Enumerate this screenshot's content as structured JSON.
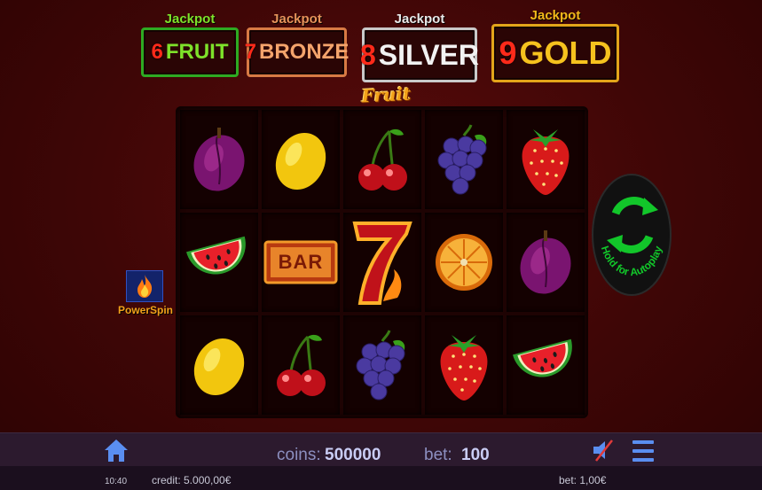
{
  "jackpots": [
    {
      "title": "Jackpot",
      "number": "6",
      "name": "FRUIT"
    },
    {
      "title": "Jackpot",
      "number": "7",
      "name": "BRONZE"
    },
    {
      "title": "Jackpot",
      "number": "8",
      "name": "SILVER"
    },
    {
      "title": "Jackpot",
      "number": "9",
      "name": "GOLD"
    }
  ],
  "game_title": "Fruit Fever",
  "reels": [
    [
      "plum",
      "watermelon",
      "lemon"
    ],
    [
      "lemon",
      "bar",
      "cherries"
    ],
    [
      "cherries",
      "seven",
      "grapes"
    ],
    [
      "grapes",
      "orange",
      "strawberry"
    ],
    [
      "strawberry",
      "plum",
      "watermelon"
    ]
  ],
  "bar_symbol_label": "BAR",
  "powerspin": {
    "label": "PowerSpin",
    "icon": "flame-icon"
  },
  "spin_button": {
    "label": "Hold for Autoplay",
    "icon": "refresh-arrows-icon",
    "color": "#12c62a"
  },
  "bottom_bar": {
    "coins_label": "coins:",
    "coins_value": "500000",
    "bet_label": "bet:",
    "bet_value": "100",
    "home_icon": "home-icon",
    "sound_icon": "speaker-muted-icon",
    "menu_icon": "hamburger-menu-icon"
  },
  "info_bar": {
    "time": "10:40",
    "credit": "credit: 5.000,00€",
    "bet": "bet: 1,00€"
  },
  "colors": {
    "background": "#3e0606",
    "bottom_bar": "#2c1a2e",
    "accent_blue": "#5a8ef0"
  }
}
